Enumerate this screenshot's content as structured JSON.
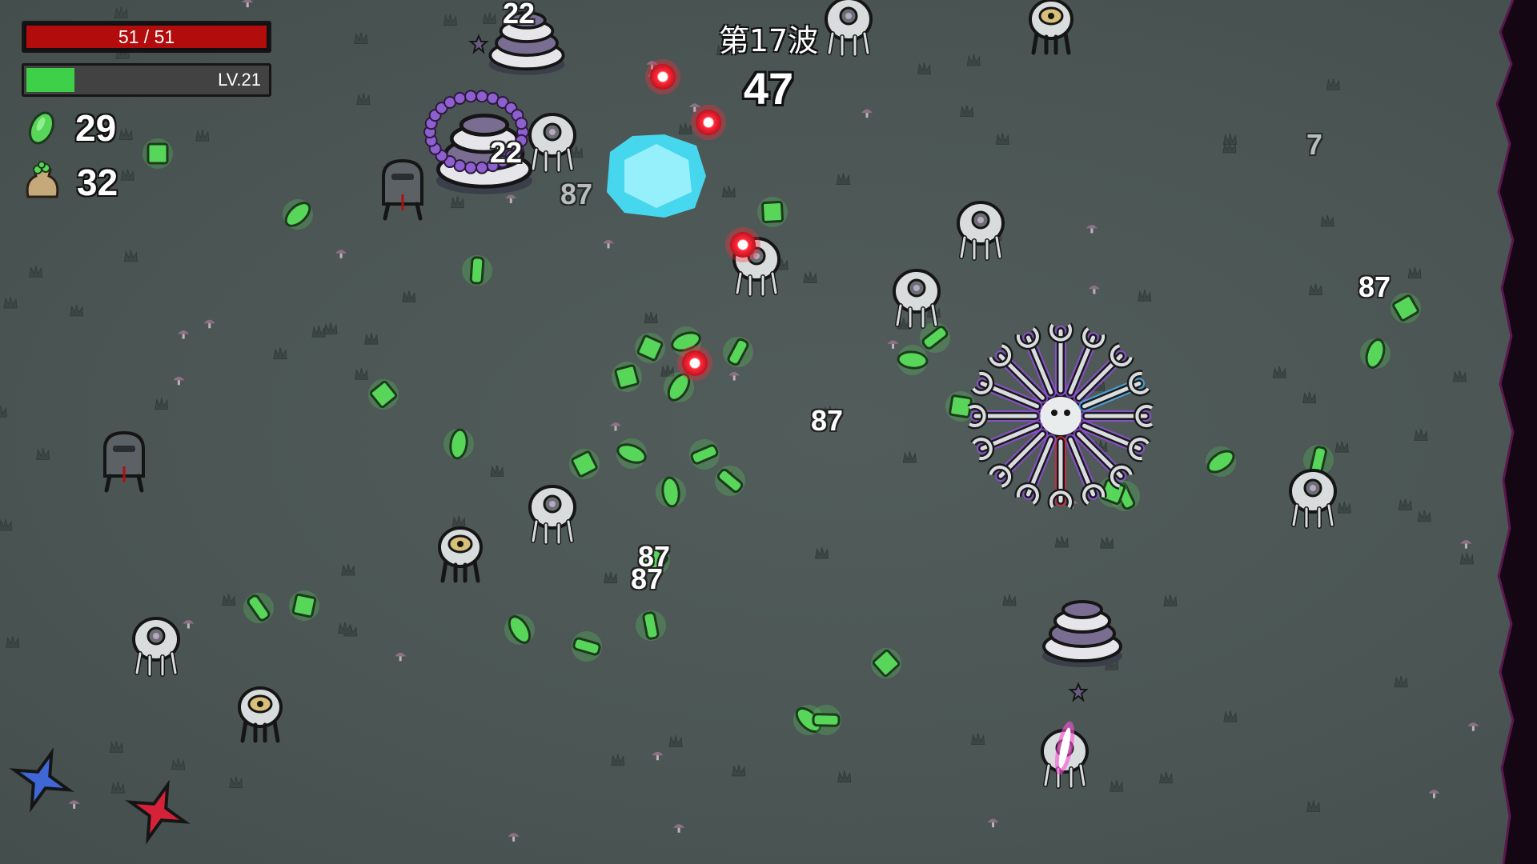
{
  "hud": {
    "hp_text": "51 / 51",
    "hp_fraction": 1.0,
    "level_text": "LV.21",
    "xp_fraction": 0.2,
    "materials_count": "29",
    "bag_count": "32",
    "materials_icon": "green-material-icon",
    "bag_icon": "material-bag-icon"
  },
  "wave": {
    "label": "第17波",
    "timer": "47"
  },
  "damage_numbers": [
    "22",
    "22",
    "87",
    "7",
    "87",
    "87",
    "87",
    "87"
  ],
  "colors": {
    "hp": "#b20c0c",
    "xp": "#3fd04a",
    "material": "#58d65a",
    "enemy_bullet": "#ff2b3a",
    "weapon_outline": "#9b4df0"
  }
}
